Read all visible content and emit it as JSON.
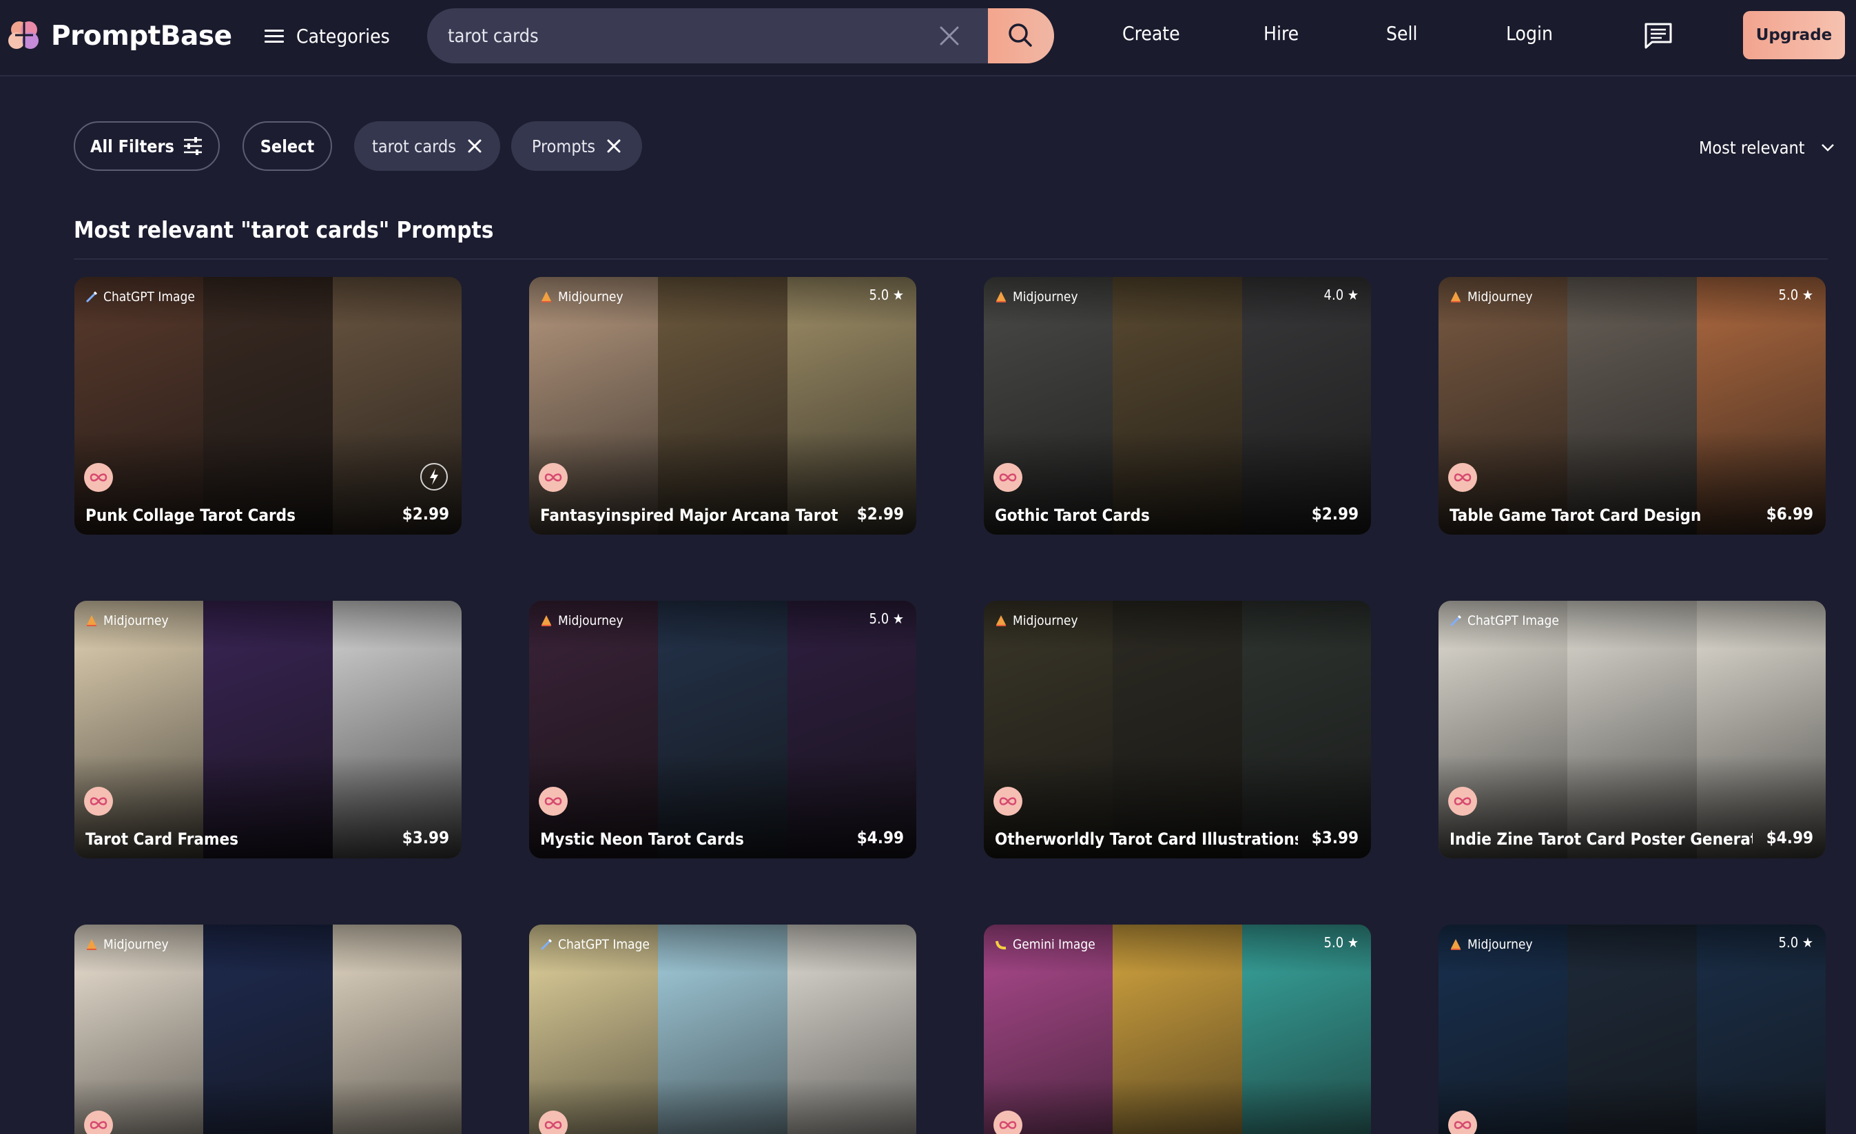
{
  "header": {
    "logo_text": "PromptBase",
    "categories_label": "Categories",
    "search_value": "tarot cards",
    "nav": [
      "Create",
      "Hire",
      "Sell",
      "Login"
    ],
    "upgrade_label": "Upgrade"
  },
  "filters": {
    "all_filters_label": "All Filters",
    "select_label": "Select",
    "chips": [
      "tarot cards",
      "Prompts"
    ],
    "sort_label": "Most relevant"
  },
  "section_title": "Most relevant \"tarot cards\" Prompts",
  "cards": [
    {
      "model": "ChatGPT Image",
      "model_icon": "pencil-icon",
      "title": "Punk Collage Tarot Cards",
      "price": "$2.99",
      "rating": "",
      "colors": [
        "#5a3a2c",
        "#3a2a22",
        "#6a5540"
      ]
    },
    {
      "model": "Midjourney",
      "model_icon": "sail-icon",
      "title": "Fantasyinspired Major Arcana Tarot Card",
      "price": "$2.99",
      "rating": "5.0 ★",
      "colors": [
        "#b89a80",
        "#6e5a3e",
        "#a09068"
      ]
    },
    {
      "model": "Midjourney",
      "model_icon": "sail-icon",
      "title": "Gothic Tarot Cards",
      "price": "$2.99",
      "rating": "4.0 ★",
      "colors": [
        "#4a4a48",
        "#5a4a30",
        "#38383a"
      ]
    },
    {
      "model": "Midjourney",
      "model_icon": "sail-icon",
      "title": "Table Game Tarot Card Design",
      "price": "$6.99",
      "rating": "5.0 ★",
      "colors": [
        "#7a5a42",
        "#686058",
        "#b06a40"
      ]
    },
    {
      "model": "Midjourney",
      "model_icon": "sail-icon",
      "title": "Tarot Card Frames",
      "price": "$3.99",
      "rating": "",
      "colors": [
        "#e8d8b8",
        "#3a2456",
        "#d8d8d8"
      ]
    },
    {
      "model": "Midjourney",
      "model_icon": "sail-icon",
      "title": "Mystic Neon Tarot Cards",
      "price": "$4.99",
      "rating": "5.0 ★",
      "colors": [
        "#3a2238",
        "#23324a",
        "#2e1e40"
      ]
    },
    {
      "model": "Midjourney",
      "model_icon": "sail-icon",
      "title": "Otherworldly Tarot Card Illustrations",
      "price": "$3.99",
      "rating": "",
      "colors": [
        "#3a3628",
        "#2c2a22",
        "#2e3430"
      ]
    },
    {
      "model": "ChatGPT Image",
      "model_icon": "pencil-icon",
      "title": "Indie Zine Tarot Card Poster Generator",
      "price": "$4.99",
      "rating": "",
      "colors": [
        "#e8e4da",
        "#e2dfd6",
        "#e6e2d8"
      ]
    },
    {
      "model": "Midjourney",
      "model_icon": "sail-icon",
      "title": "",
      "price": "",
      "rating": "",
      "colors": [
        "#f2e8d8",
        "#1e2a50",
        "#e8dcc8"
      ]
    },
    {
      "model": "ChatGPT Image",
      "model_icon": "pencil-icon",
      "title": "",
      "price": "",
      "rating": "",
      "colors": [
        "#e8d8a0",
        "#a8d4e4",
        "#e4e0d8"
      ]
    },
    {
      "model": "Gemini Image",
      "model_icon": "banana-icon",
      "title": "",
      "price": "",
      "rating": "5.0 ★",
      "colors": [
        "#b04a90",
        "#d8a840",
        "#38a8a0"
      ]
    },
    {
      "model": "Midjourney",
      "model_icon": "sail-icon",
      "title": "",
      "price": "",
      "rating": "5.0 ★",
      "colors": [
        "#183050",
        "#1e2a3a",
        "#1a2e48"
      ]
    }
  ]
}
